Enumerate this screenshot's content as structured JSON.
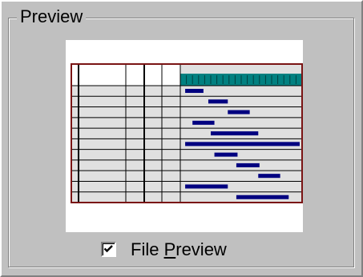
{
  "group": {
    "title": "Preview"
  },
  "file_preview": {
    "checked": true,
    "label_before": "File ",
    "label_accel": "P",
    "label_after": "review"
  },
  "preview": {
    "grid_rows": 11,
    "gantt_bars": [
      {
        "row": 0,
        "start": 0.04,
        "end": 0.19
      },
      {
        "row": 1,
        "start": 0.23,
        "end": 0.39
      },
      {
        "row": 2,
        "start": 0.39,
        "end": 0.57
      },
      {
        "row": 3,
        "start": 0.1,
        "end": 0.28
      },
      {
        "row": 4,
        "start": 0.25,
        "end": 0.64
      },
      {
        "row": 5,
        "start": 0.04,
        "end": 0.98
      },
      {
        "row": 6,
        "start": 0.28,
        "end": 0.47
      },
      {
        "row": 7,
        "start": 0.46,
        "end": 0.65
      },
      {
        "row": 8,
        "start": 0.64,
        "end": 0.82
      },
      {
        "row": 9,
        "start": 0.04,
        "end": 0.39
      },
      {
        "row": 10,
        "start": 0.46,
        "end": 0.89
      }
    ],
    "colors": {
      "border": "#7a1414",
      "header_fill": "#008080",
      "bar_fill": "#000080",
      "grid_fill": "#e0e0e0"
    }
  }
}
